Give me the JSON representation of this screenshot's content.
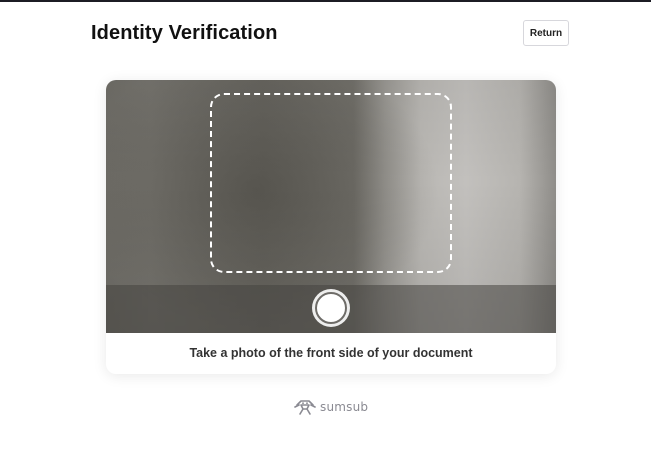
{
  "header": {
    "title": "Identity Verification",
    "return_label": "Return"
  },
  "camera": {
    "instruction": "Take a photo of the front side of your document"
  },
  "footer": {
    "brand_name": "sumsub",
    "brand_icon": "sumsub-logo-icon"
  },
  "colors": {
    "title": "#111111",
    "frame_guide": "#ffffff",
    "brand_text": "#8a8a92"
  }
}
